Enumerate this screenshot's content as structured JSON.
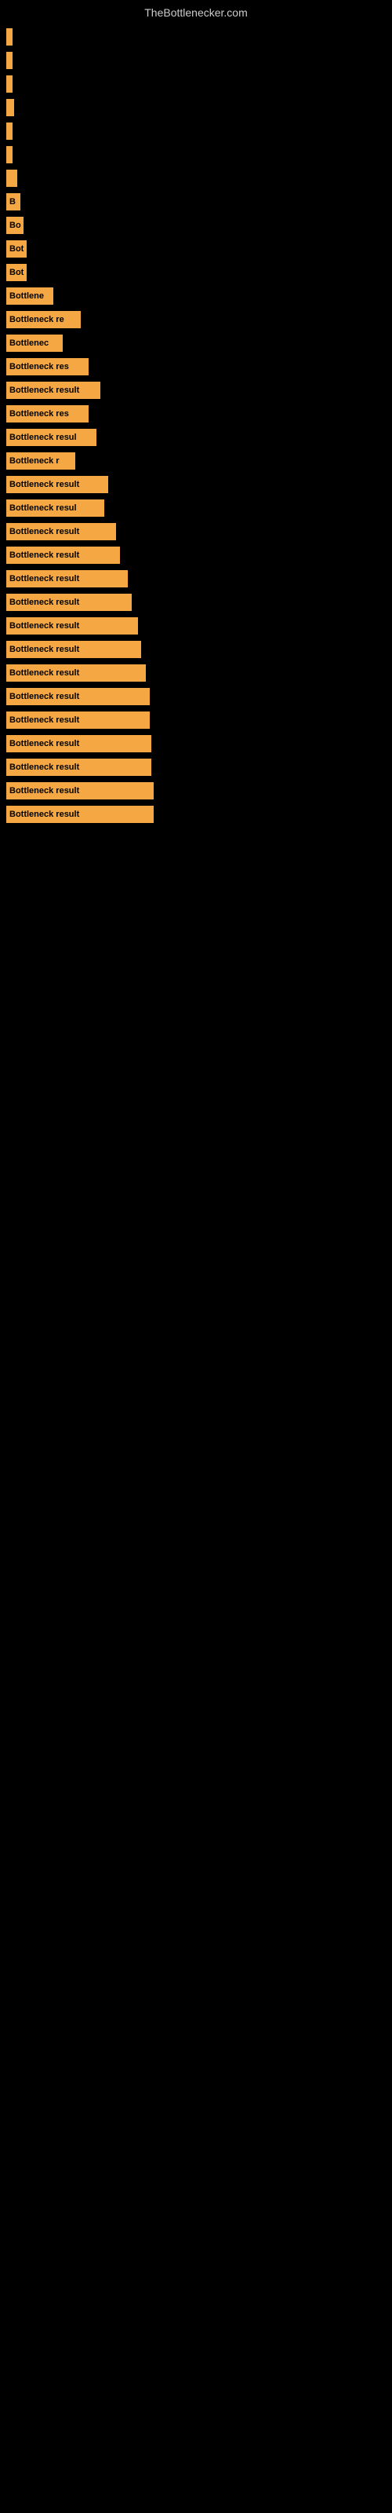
{
  "site": {
    "title": "TheBottlenecker.com"
  },
  "bars": [
    {
      "label": "",
      "width": 8
    },
    {
      "label": "",
      "width": 8
    },
    {
      "label": "",
      "width": 8
    },
    {
      "label": "",
      "width": 10
    },
    {
      "label": "",
      "width": 8
    },
    {
      "label": "",
      "width": 8
    },
    {
      "label": "",
      "width": 14
    },
    {
      "label": "B",
      "width": 18
    },
    {
      "label": "Bo",
      "width": 22
    },
    {
      "label": "Bot",
      "width": 26
    },
    {
      "label": "Bot",
      "width": 26
    },
    {
      "label": "Bottlene",
      "width": 60
    },
    {
      "label": "Bottleneck re",
      "width": 95
    },
    {
      "label": "Bottlenec",
      "width": 72
    },
    {
      "label": "Bottleneck res",
      "width": 105
    },
    {
      "label": "Bottleneck result",
      "width": 120
    },
    {
      "label": "Bottleneck res",
      "width": 105
    },
    {
      "label": "Bottleneck resul",
      "width": 115
    },
    {
      "label": "Bottleneck r",
      "width": 88
    },
    {
      "label": "Bottleneck result",
      "width": 130
    },
    {
      "label": "Bottleneck resul",
      "width": 125
    },
    {
      "label": "Bottleneck result",
      "width": 140
    },
    {
      "label": "Bottleneck result",
      "width": 145
    },
    {
      "label": "Bottleneck result",
      "width": 155
    },
    {
      "label": "Bottleneck result",
      "width": 160
    },
    {
      "label": "Bottleneck result",
      "width": 168
    },
    {
      "label": "Bottleneck result",
      "width": 172
    },
    {
      "label": "Bottleneck result",
      "width": 178
    },
    {
      "label": "Bottleneck result",
      "width": 183
    },
    {
      "label": "Bottleneck result",
      "width": 183
    },
    {
      "label": "Bottleneck result",
      "width": 185
    },
    {
      "label": "Bottleneck result",
      "width": 185
    },
    {
      "label": "Bottleneck result",
      "width": 188
    },
    {
      "label": "Bottleneck result",
      "width": 188
    }
  ]
}
